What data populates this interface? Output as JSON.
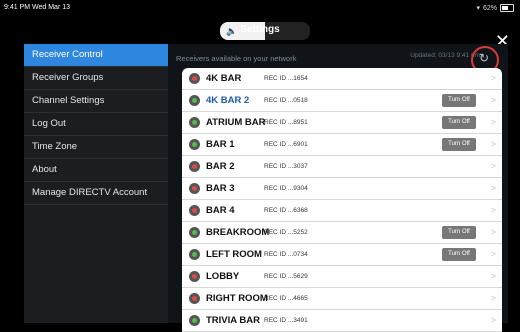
{
  "status": {
    "time": "9:41 PM  Wed Mar 13",
    "battery": "62%",
    "battery_level": 0.62
  },
  "volume_level": 0.5,
  "header": {
    "title": "Settings",
    "close": "✕"
  },
  "sidebar": {
    "items": [
      {
        "label": "Receiver Control"
      },
      {
        "label": "Receiver Groups"
      },
      {
        "label": "Channel Settings"
      },
      {
        "label": "Log Out"
      },
      {
        "label": "Time Zone"
      },
      {
        "label": "About"
      },
      {
        "label": "Manage DIRECTV Account"
      }
    ]
  },
  "main": {
    "receivers_header": "Receivers available on your network",
    "updated": "Updated: 03/13 9:41 pm"
  },
  "receivers": [
    {
      "name": "4K BAR",
      "rec_id": "REC ID ...1654",
      "on": false,
      "turn_off": ""
    },
    {
      "name": "4K BAR 2",
      "rec_id": "REC ID ...0518",
      "on": true,
      "turn_off": "Turn Off"
    },
    {
      "name": "ATRIUM BAR",
      "rec_id": "REC ID ...8951",
      "on": true,
      "turn_off": "Turn Off"
    },
    {
      "name": "BAR 1",
      "rec_id": "REC ID ...6901",
      "on": true,
      "turn_off": "Turn Off"
    },
    {
      "name": "BAR 2",
      "rec_id": "REC ID ...3037",
      "on": false,
      "turn_off": ""
    },
    {
      "name": "BAR 3",
      "rec_id": "REC ID ...9304",
      "on": false,
      "turn_off": ""
    },
    {
      "name": "BAR 4",
      "rec_id": "REC ID ...6368",
      "on": false,
      "turn_off": ""
    },
    {
      "name": "BREAKROOM",
      "rec_id": "REC ID ...5252",
      "on": true,
      "turn_off": "Turn Off"
    },
    {
      "name": "LEFT ROOM",
      "rec_id": "REC ID ...0734",
      "on": true,
      "turn_off": "Turn Off"
    },
    {
      "name": "LOBBY",
      "rec_id": "REC ID ...5629",
      "on": false,
      "turn_off": ""
    },
    {
      "name": "RIGHT ROOM",
      "rec_id": "REC ID ...4665",
      "on": false,
      "turn_off": ""
    },
    {
      "name": "TRIVIA BAR",
      "rec_id": "REC ID ...3491",
      "on": true,
      "turn_off": ""
    }
  ]
}
